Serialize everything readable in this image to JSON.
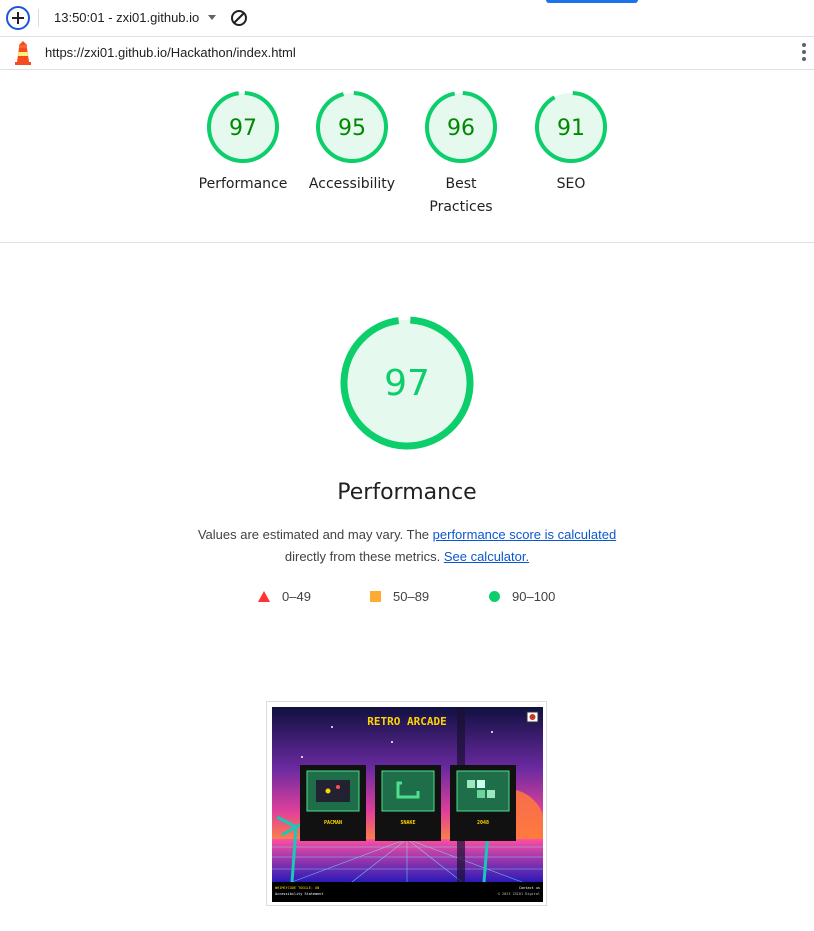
{
  "toolbar": {
    "report_title": "13:50:01 - zxi01.github.io",
    "icons": [
      "plus-icon",
      "dropdown-caret-icon",
      "clear-icon"
    ]
  },
  "urlbar": {
    "url": "https://zxi01.github.io/Hackathon/index.html",
    "icons": [
      "lighthouse-icon",
      "more-vert-icon"
    ]
  },
  "summary": [
    {
      "score": "97",
      "label": "Performance"
    },
    {
      "score": "95",
      "label": "Accessibility"
    },
    {
      "score": "96",
      "label": "Best Practices"
    },
    {
      "score": "91",
      "label": "SEO"
    }
  ],
  "main": {
    "score": "97",
    "title": "Performance",
    "desc_prefix": "Values are estimated and may vary. The ",
    "desc_link1": "performance score is calculated",
    "desc_middle": "directly from these metrics.",
    "desc_link2": "See calculator."
  },
  "legend": {
    "fail": "0–49",
    "average": "50–89",
    "pass": "90–100"
  },
  "screenshot": {
    "site_title": "RETRO ARCADE",
    "games": [
      "PACMAN",
      "SNAKE",
      "2048"
    ],
    "footer_left_1": "WHIMSYCODE TOGGLE: ON",
    "footer_left_2": "Accessibility Statement",
    "footer_right_1": "Contact us",
    "footer_right_2": "© 2023 ZXI01 Digital"
  },
  "colors": {
    "pass": "#0cce6b",
    "pass_text": "#008800",
    "pass_fill": "#e6f9ef",
    "average": "#ffaa33",
    "fail": "#ff3333",
    "link": "#0b57d0"
  }
}
